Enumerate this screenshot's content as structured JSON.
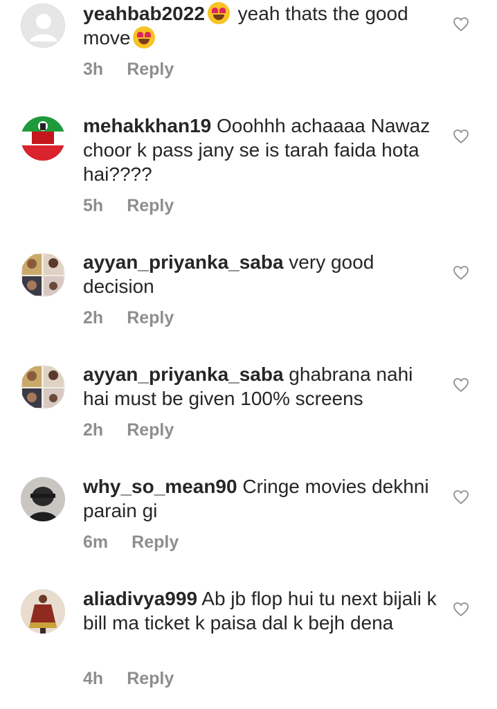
{
  "comments": [
    {
      "username": "yeahbab2022",
      "text_before": "",
      "text_after": " yeah thats the good",
      "text_line2": "move",
      "time": "3h",
      "reply": "Reply",
      "avatar": "default-avatar"
    },
    {
      "username": "mehakkhan19",
      "text": " Ooohhh achaaaa Nawaz choor k pass jany se is tarah faida hota hai????",
      "time": "5h",
      "reply": "Reply",
      "avatar": "party-flag-avatar"
    },
    {
      "username": "ayyan_priyanka_saba",
      "text": " very good decision",
      "time": "2h",
      "reply": "Reply",
      "avatar": "photo-collage-avatar"
    },
    {
      "username": "ayyan_priyanka_saba",
      "text": " ghabrana nahi hai must be given 100% screens",
      "time": "2h",
      "reply": "Reply",
      "avatar": "photo-collage-avatar"
    },
    {
      "username": "why_so_mean90",
      "text": " Cringe movies dekhni parain gi",
      "time": "6m",
      "reply": "Reply",
      "avatar": "dark-portrait-avatar"
    },
    {
      "username": "aliadivya999",
      "text": " Ab jb flop hui tu next bijali k bill ma ticket k paisa dal k bejh dena",
      "time": "4h",
      "reply": "Reply",
      "avatar": "dress-photo-avatar"
    }
  ],
  "colors": {
    "text": "#262626",
    "meta": "#8e8e8e",
    "heart_stroke": "#8e8e8e"
  }
}
